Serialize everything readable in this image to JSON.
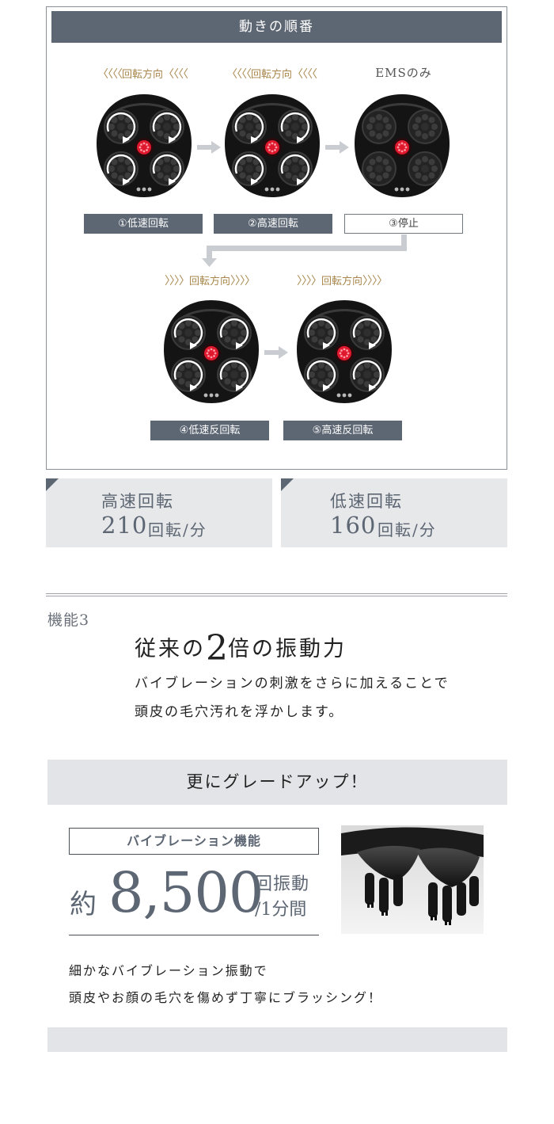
{
  "sequence": {
    "title": "動きの順番",
    "steps": [
      {
        "top_label": "回転方向",
        "top_type": "left",
        "label": "①低速回転",
        "style": "dark"
      },
      {
        "top_label": "回転方向",
        "top_type": "left",
        "label": "②高速回転",
        "style": "dark"
      },
      {
        "top_label": "EMSのみ",
        "top_type": "ems",
        "label": "③停止",
        "style": "light"
      },
      {
        "top_label": "回転方向",
        "top_type": "right",
        "label": "④低速反回転",
        "style": "dark"
      },
      {
        "top_label": "回転方向",
        "top_type": "right",
        "label": "⑤高速反回転",
        "style": "dark"
      }
    ],
    "left_chevrons": "〈〈〈〈",
    "right_chevrons": "〉〉〉〉"
  },
  "speeds": [
    {
      "title": "高速回転",
      "value": "210",
      "unit": "回転/分"
    },
    {
      "title": "低速回転",
      "value": "160",
      "unit": "回転/分"
    }
  ],
  "feature": {
    "number": "機能3",
    "head_pre": "従来の",
    "head_big": "2",
    "head_post": "倍の振動力",
    "body": [
      "バイブレーションの刺激をさらに加えることで",
      "頭皮の毛穴汚れを浮かします。"
    ]
  },
  "upgrade": {
    "banner": "更にグレードアップ！",
    "box_label": "バイブレーション機能",
    "approx": "約",
    "number": "8,500",
    "unit_line1": "回振動",
    "unit_line2": "/1分間",
    "desc": [
      "細かなバイブレーション振動で",
      "頭皮やお顔の毛穴を傷めず丁寧にブラッシング！"
    ]
  },
  "colors": {
    "slate": "#5d6673",
    "gold": "#a9864b",
    "panel_gray": "#e7e8ea",
    "led_red": "#e0182d"
  }
}
